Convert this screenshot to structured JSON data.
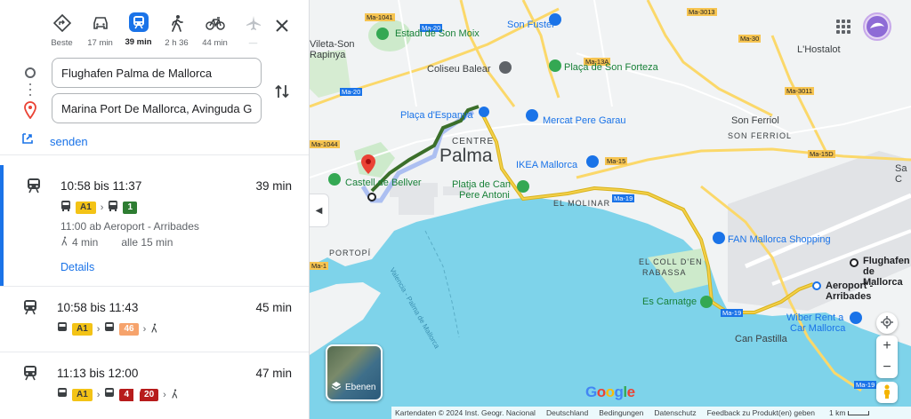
{
  "modes": [
    {
      "label": "Beste",
      "icon": "best-route-icon"
    },
    {
      "label": "17 min",
      "icon": "car-icon"
    },
    {
      "label": "39 min",
      "icon": "transit-icon",
      "active": true
    },
    {
      "label": "2 h 36",
      "icon": "walk-icon"
    },
    {
      "label": "44 min",
      "icon": "bicycle-icon"
    },
    {
      "label": "—",
      "icon": "flight-icon"
    }
  ],
  "origin": "Flughafen Palma de Mallorca",
  "destination": "Marina Port De Mallorca, Avinguda Gabriel Roca",
  "send_label": "senden",
  "routes": [
    {
      "time": "10:58 bis 11:37",
      "duration": "39 min",
      "badges": [
        "A1",
        "1"
      ],
      "depart": "11:00 ab Aeroport - Arribades",
      "walk": "4 min",
      "frequency": "alle 15 min",
      "details_label": "Details"
    },
    {
      "time": "10:58 bis 11:43",
      "duration": "45 min",
      "badges": [
        "A1",
        "46"
      ]
    },
    {
      "time": "11:13 bis 12:00",
      "duration": "47 min",
      "badges": [
        "A1",
        "4",
        "20"
      ]
    }
  ],
  "map": {
    "places": {
      "palma": "Palma",
      "centre": "CENTRE",
      "estadi": "Estadi de Son Moix",
      "son_fuster": "Son Fuster",
      "coliseu": "Coliseu Balear",
      "placa_sf": "Plaça de Son Forteza",
      "placa_esp": "Plaça d'Espanya",
      "mercat": "Mercat Pere Garau",
      "ikea": "IKEA Mallorca",
      "platja": "Platja de Can",
      "pere_antoni": "Pere Antoni",
      "castell": "Castell de Bellver",
      "el_molinar": "EL MOLINAR",
      "porto_pi": "PORTOPÍ",
      "son_ferriol": "Son Ferriol",
      "son_ferriol_caps": "SON FERRIOL",
      "hostalot": "L'Hostalot",
      "vileta": "Vileta-Son",
      "rapinya": "Rapinya",
      "fan": "FAN Mallorca Shopping",
      "coll": "EL COLL D'EN",
      "rabassa": "RABASSA",
      "carnatge": "Es Carnatge",
      "can_pastilla": "Can Pastilla",
      "wiber": "Wiber Rent a",
      "car_mallorca": "Car Mallorca",
      "flughafen": "Flughafen",
      "de_mallorca": "de Mallorca",
      "aeroport": "Aeroport - Arribades",
      "valencia_palma": "Valencia - Palma de Mallorca",
      "sa": "Sa C"
    },
    "roads": [
      "Ma-1041",
      "Ma-20",
      "Ma-13A",
      "Ma-3013",
      "Ma-30",
      "Ma-3011",
      "Ma-1044",
      "Ma-15",
      "Ma-15D",
      "Ma-19",
      "Ma-20",
      "Ma-1",
      "Ma-1",
      "Ma-19",
      "Ma-19",
      "Ma-19"
    ],
    "layers_label": "Ebenen",
    "footer": [
      "Kartendaten © 2024 Inst. Geogr. Nacional",
      "Deutschland",
      "Bedingungen",
      "Datenschutz",
      "Feedback zu Produkt(en) geben"
    ],
    "scale": "1 km",
    "google": [
      "G",
      "o",
      "o",
      "g",
      "l",
      "e"
    ],
    "google_colors": [
      "#4285f4",
      "#ea4335",
      "#fbbc05",
      "#4285f4",
      "#34a853",
      "#ea4335"
    ]
  }
}
